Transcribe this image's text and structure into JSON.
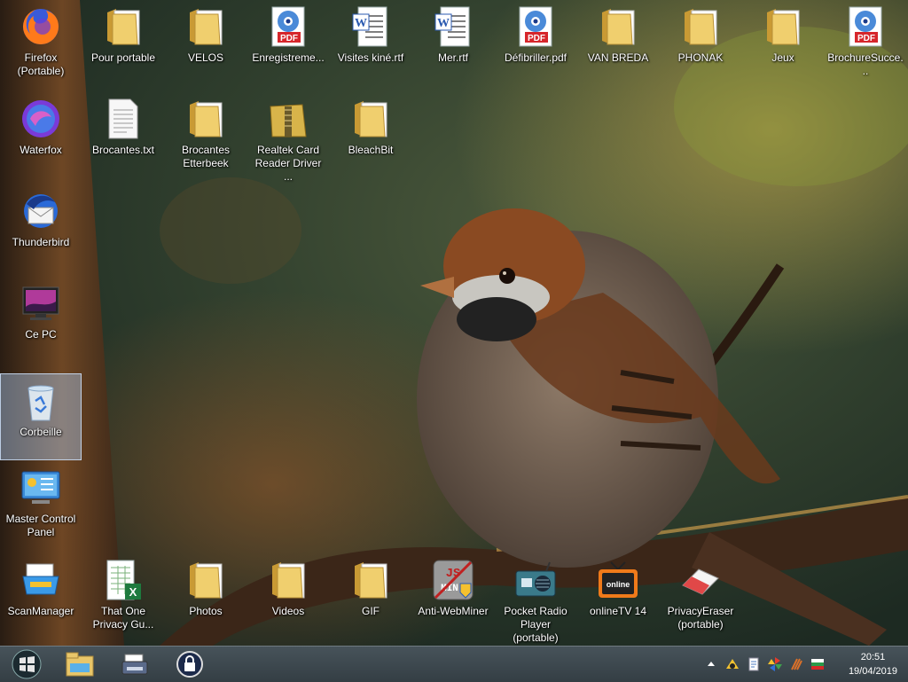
{
  "desktop": {
    "icons": [
      {
        "id": "firefox",
        "label": "Firefox\n(Portable)",
        "type": "firefox-icon"
      },
      {
        "id": "pour-portable",
        "label": "Pour portable",
        "type": "folder-icon"
      },
      {
        "id": "velos",
        "label": "VELOS",
        "type": "folder-icon"
      },
      {
        "id": "enregistrement",
        "label": "Enregistreme...",
        "type": "pdf-icon"
      },
      {
        "id": "visites-kine",
        "label": "Visites kiné.rtf",
        "type": "word-doc-icon"
      },
      {
        "id": "mer",
        "label": "Mer.rtf",
        "type": "word-doc-icon"
      },
      {
        "id": "defibriller",
        "label": "Défibriller.pdf",
        "type": "pdf-icon"
      },
      {
        "id": "van-breda",
        "label": "VAN BREDA",
        "type": "folder-icon"
      },
      {
        "id": "phonak",
        "label": "PHONAK",
        "type": "folder-icon"
      },
      {
        "id": "jeux",
        "label": "Jeux",
        "type": "folder-icon"
      },
      {
        "id": "brochure",
        "label": "BrochureSucce...",
        "type": "pdf-icon"
      },
      {
        "id": "waterfox",
        "label": "Waterfox",
        "type": "waterfox-icon"
      },
      {
        "id": "brocantes-txt",
        "label": "Brocantes.txt",
        "type": "text-file-icon"
      },
      {
        "id": "brocantes-etterbeek",
        "label": "Brocantes\nEtterbeek",
        "type": "folder-icon"
      },
      {
        "id": "realtek",
        "label": "Realtek Card\nReader Driver ...",
        "type": "zip-folder-icon"
      },
      {
        "id": "bleachbit",
        "label": "BleachBit",
        "type": "folder-icon"
      },
      {
        "id": "thunderbird",
        "label": "Thunderbird",
        "type": "thunderbird-icon"
      },
      {
        "id": "ce-pc",
        "label": "Ce PC",
        "type": "computer-icon"
      },
      {
        "id": "corbeille",
        "label": "Corbeille",
        "type": "recycle-bin-icon",
        "selected": true
      },
      {
        "id": "master-control",
        "label": "Master Control\nPanel",
        "type": "control-panel-icon"
      },
      {
        "id": "scanmanager",
        "label": "ScanManager",
        "type": "scanner-icon"
      },
      {
        "id": "that-one-privacy",
        "label": "That One\nPrivacy Gu...",
        "type": "excel-file-icon"
      },
      {
        "id": "photos",
        "label": "Photos",
        "type": "folder-icon"
      },
      {
        "id": "videos",
        "label": "Videos",
        "type": "folder-icon"
      },
      {
        "id": "gif",
        "label": "GIF",
        "type": "folder-icon"
      },
      {
        "id": "anti-webminer",
        "label": "Anti-WebMiner",
        "type": "anti-webminer-icon"
      },
      {
        "id": "pocket-radio",
        "label": "Pocket Radio\nPlayer (portable)",
        "type": "radio-icon"
      },
      {
        "id": "onlinetv",
        "label": "onlineTV 14",
        "type": "onlinetv-icon",
        "icon_text": "online"
      },
      {
        "id": "privacyeraser",
        "label": "PrivacyEraser\n(portable)",
        "type": "eraser-icon"
      }
    ]
  },
  "taskbar": {
    "start": {
      "icon": "windows-logo-icon"
    },
    "pinned": [
      {
        "id": "explorer",
        "icon": "file-explorer-icon"
      },
      {
        "id": "scanner",
        "icon": "scanner-app-icon"
      },
      {
        "id": "vpn",
        "icon": "lock-app-icon"
      }
    ],
    "tray": [
      "show-hidden-icons-arrow",
      "antivirus-tray-icon",
      "document-tray-icon",
      "pinwheel-tray-icon",
      "tool-tray-icon",
      "bulgarian-flag-tray-icon"
    ],
    "clock": {
      "time": "20:51",
      "date": "19/04/2019"
    }
  },
  "colors": {
    "taskbar": "#3b454b",
    "selection": "#aac8eb",
    "folder": "#e8c66a",
    "pdf_red": "#d6262b"
  }
}
